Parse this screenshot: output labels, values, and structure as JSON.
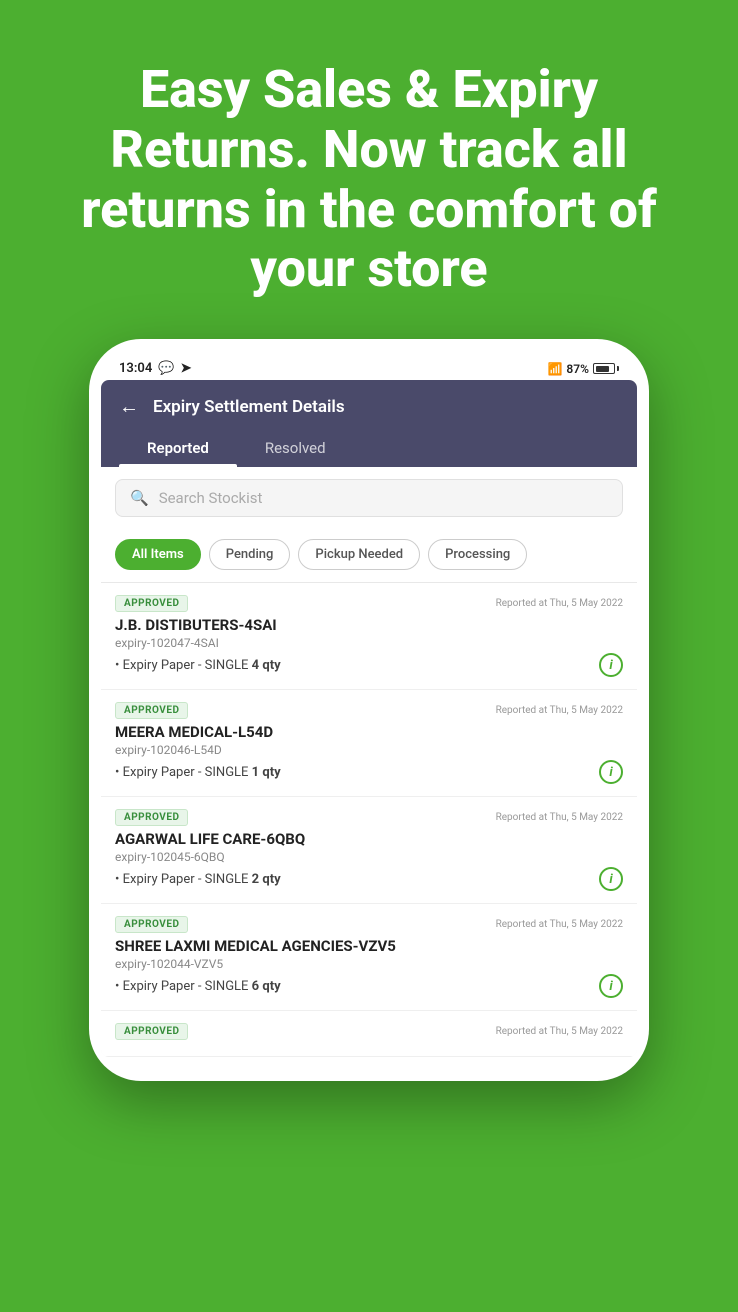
{
  "hero": {
    "text": "Easy Sales & Expiry Returns. Now track all returns in the comfort of your store"
  },
  "statusBar": {
    "time": "13:04",
    "battery": "87%"
  },
  "header": {
    "title": "Expiry Settlement Details",
    "tabs": [
      {
        "label": "Reported",
        "active": true
      },
      {
        "label": "Resolved",
        "active": false
      }
    ]
  },
  "search": {
    "placeholder": "Search Stockist"
  },
  "filters": [
    {
      "label": "All Items",
      "active": true
    },
    {
      "label": "Pending",
      "active": false
    },
    {
      "label": "Pickup Needed",
      "active": false
    },
    {
      "label": "Processing",
      "active": false
    }
  ],
  "items": [
    {
      "badge": "APPROVED",
      "date": "Reported at Thu, 5 May 2022",
      "name": "J.B. DISTIBUTERS-4SAI",
      "id": "expiry-102047-4SAI",
      "detail": "Expiry Paper - SINGLE",
      "qty": "4 qty"
    },
    {
      "badge": "APPROVED",
      "date": "Reported at Thu, 5 May 2022",
      "name": "MEERA MEDICAL-L54D",
      "id": "expiry-102046-L54D",
      "detail": "Expiry Paper - SINGLE",
      "qty": "1 qty"
    },
    {
      "badge": "APPROVED",
      "date": "Reported at Thu, 5 May 2022",
      "name": "AGARWAL LIFE CARE-6QBQ",
      "id": "expiry-102045-6QBQ",
      "detail": "Expiry Paper - SINGLE",
      "qty": "2 qty"
    },
    {
      "badge": "APPROVED",
      "date": "Reported at Thu, 5 May 2022",
      "name": "SHREE LAXMI MEDICAL AGENCIES-VZV5",
      "id": "expiry-102044-VZV5",
      "detail": "Expiry Paper - SINGLE",
      "qty": "6 qty"
    },
    {
      "badge": "APPROVED",
      "date": "Reported at Thu, 5 May 2022",
      "name": "",
      "id": "",
      "detail": "",
      "qty": ""
    }
  ]
}
